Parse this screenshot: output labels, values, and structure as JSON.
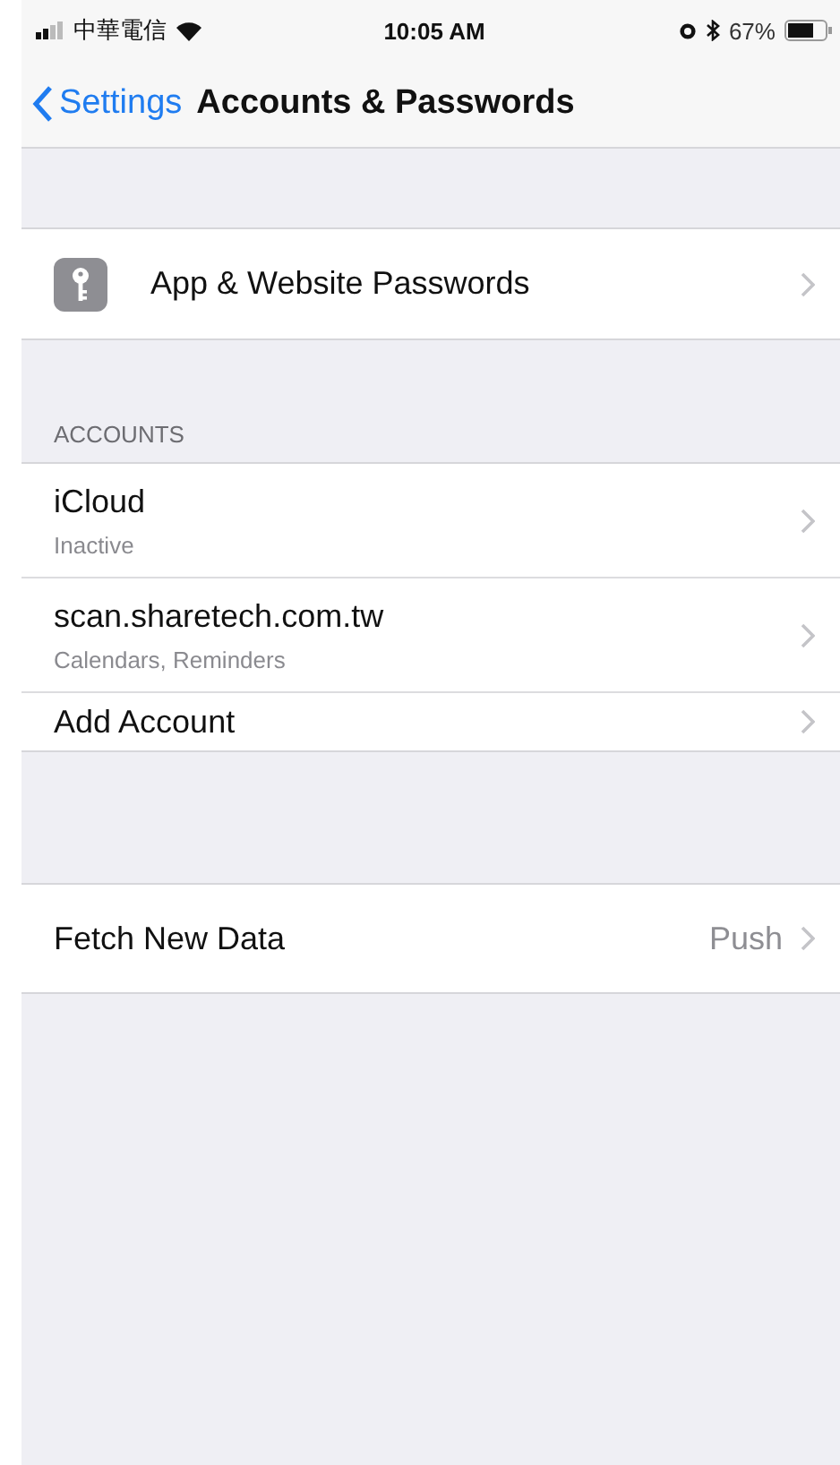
{
  "status_bar": {
    "carrier": "中華電信",
    "time": "10:05 AM",
    "battery": "67%"
  },
  "nav": {
    "back": "Settings",
    "title": "Accounts & Passwords"
  },
  "passwords_row": {
    "label": "App & Website Passwords"
  },
  "accounts": {
    "header": "ACCOUNTS",
    "items": [
      {
        "title": "iCloud",
        "subtitle": "Inactive"
      },
      {
        "title": "scan.sharetech.com.tw",
        "subtitle": "Calendars, Reminders"
      },
      {
        "title": "Add Account"
      }
    ]
  },
  "fetch_row": {
    "label": "Fetch New Data",
    "value": "Push"
  }
}
